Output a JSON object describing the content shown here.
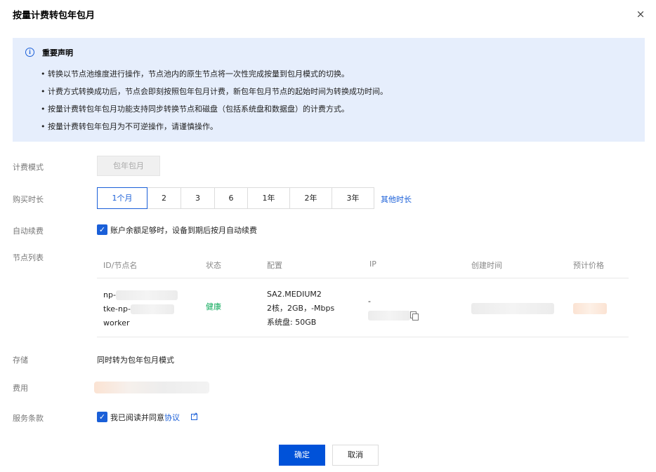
{
  "dialog": {
    "title": "按量计费转包年包月",
    "close_icon": "×"
  },
  "notice": {
    "icon": "i",
    "title": "重要声明",
    "items": [
      "转换以节点池维度进行操作，节点池内的原生节点将一次性完成按量到包月模式的切换。",
      "计费方式转换成功后，节点会即刻按照包年包月计费，新包年包月节点的起始时间为转换成功时间。",
      "按量计费转包年包月功能支持同步转换节点和磁盘（包括系统盘和数据盘）的计费方式。",
      "按量计费转包年包月为不可逆操作，请谨慎操作。"
    ]
  },
  "form": {
    "billing_mode_label": "计费模式",
    "billing_mode_value": "包年包月",
    "duration_label": "购买时长",
    "durations": [
      "1个月",
      "2",
      "3",
      "6",
      "1年",
      "2年",
      "3年"
    ],
    "duration_selected": "1个月",
    "other_duration": "其他时长",
    "auto_renew_label": "自动续费",
    "auto_renew_text": "账户余额足够时，设备到期后按月自动续费",
    "auto_renew_checked": true,
    "node_list_label": "节点列表",
    "storage_label": "存储",
    "storage_value": "同时转为包年包月模式",
    "cost_label": "费用",
    "terms_label": "服务条款",
    "terms_text": "我已阅读并同意",
    "terms_link": "协议",
    "terms_checked": true
  },
  "node_table": {
    "headers": [
      "ID/节点名",
      "状态",
      "配置",
      "IP",
      "创建时间",
      "预计价格"
    ],
    "row": {
      "id_line1": "np-",
      "id_line2": "tke-np-",
      "id_line3": "worker",
      "status": "健康",
      "config_line1": "SA2.MEDIUM2",
      "config_line2": "2核，2GB，-Mbps",
      "config_line3": "系统盘: 50GB",
      "ip_line1": "-"
    }
  },
  "buttons": {
    "confirm": "确定",
    "cancel": "取消"
  },
  "colors": {
    "accent": "#0052d9",
    "notice_bg": "#e6eefc",
    "healthy": "#0aa858"
  },
  "icons": {
    "close": "close-icon",
    "info": "info-icon",
    "check": "check-icon",
    "copy": "copy-icon",
    "external_link": "external-link-icon"
  }
}
